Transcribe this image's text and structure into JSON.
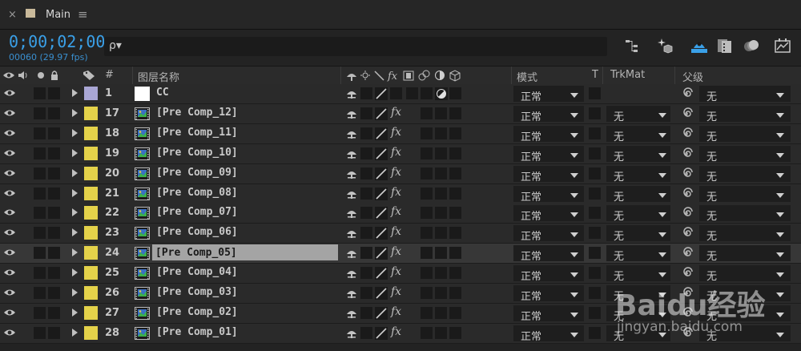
{
  "tab": {
    "close": "×",
    "title": "Main",
    "menu": "≡"
  },
  "timecode": {
    "value": "0;00;02;00",
    "frames_fps": "00060 (29.97 fps)"
  },
  "search": {
    "icon": "ρ▾",
    "placeholder": ""
  },
  "toolbar": {
    "icons": [
      "flowchart-icon",
      "draft-3d-icon",
      "hide-shy-icon",
      "frame-blend-icon",
      "motion-blur-icon",
      "graph-editor-icon"
    ]
  },
  "columns": {
    "number": "#",
    "layer_name": "图层名称",
    "mode": "模式",
    "t": "T",
    "trkmat": "TrkMat",
    "parent": "父级"
  },
  "switch_glyphs": {
    "shy": "♣",
    "fx": "fx",
    "quality": "/"
  },
  "colors": {
    "timecode": "#3aa0e8",
    "label_yellow": "#e4d24a",
    "label_lavender": "#a9a6d4",
    "selected_row": "#373737",
    "name_highlight": "#a4a4a4"
  },
  "layers": [
    {
      "num": "1",
      "name": "CC",
      "label_color": "#a9a6d4",
      "type": "solid",
      "mode": "正常",
      "trkmat": "",
      "parent": "无",
      "selected": false
    },
    {
      "num": "17",
      "name": "[Pre Comp_12]",
      "label_color": "#e4d24a",
      "type": "comp",
      "mode": "正常",
      "trkmat": "无",
      "parent": "无",
      "selected": false
    },
    {
      "num": "18",
      "name": "[Pre Comp_11]",
      "label_color": "#e4d24a",
      "type": "comp",
      "mode": "正常",
      "trkmat": "无",
      "parent": "无",
      "selected": false
    },
    {
      "num": "19",
      "name": "[Pre Comp_10]",
      "label_color": "#e4d24a",
      "type": "comp",
      "mode": "正常",
      "trkmat": "无",
      "parent": "无",
      "selected": false
    },
    {
      "num": "20",
      "name": "[Pre Comp_09]",
      "label_color": "#e4d24a",
      "type": "comp",
      "mode": "正常",
      "trkmat": "无",
      "parent": "无",
      "selected": false
    },
    {
      "num": "21",
      "name": "[Pre Comp_08]",
      "label_color": "#e4d24a",
      "type": "comp",
      "mode": "正常",
      "trkmat": "无",
      "parent": "无",
      "selected": false
    },
    {
      "num": "22",
      "name": "[Pre Comp_07]",
      "label_color": "#e4d24a",
      "type": "comp",
      "mode": "正常",
      "trkmat": "无",
      "parent": "无",
      "selected": false
    },
    {
      "num": "23",
      "name": "[Pre Comp_06]",
      "label_color": "#e4d24a",
      "type": "comp",
      "mode": "正常",
      "trkmat": "无",
      "parent": "无",
      "selected": false
    },
    {
      "num": "24",
      "name": "[Pre Comp_05]",
      "label_color": "#e4d24a",
      "type": "comp",
      "mode": "正常",
      "trkmat": "无",
      "parent": "无",
      "selected": true
    },
    {
      "num": "25",
      "name": "[Pre Comp_04]",
      "label_color": "#e4d24a",
      "type": "comp",
      "mode": "正常",
      "trkmat": "无",
      "parent": "无",
      "selected": false
    },
    {
      "num": "26",
      "name": "[Pre Comp_03]",
      "label_color": "#e4d24a",
      "type": "comp",
      "mode": "正常",
      "trkmat": "无",
      "parent": "无",
      "selected": false
    },
    {
      "num": "27",
      "name": "[Pre Comp_02]",
      "label_color": "#e4d24a",
      "type": "comp",
      "mode": "正常",
      "trkmat": "无",
      "parent": "无",
      "selected": false
    },
    {
      "num": "28",
      "name": "[Pre Comp_01]",
      "label_color": "#e4d24a",
      "type": "comp",
      "mode": "正常",
      "trkmat": "无",
      "parent": "无",
      "selected": false
    }
  ],
  "watermark": {
    "brand": "Baidu经验",
    "url": "jingyan.baidu.com"
  }
}
